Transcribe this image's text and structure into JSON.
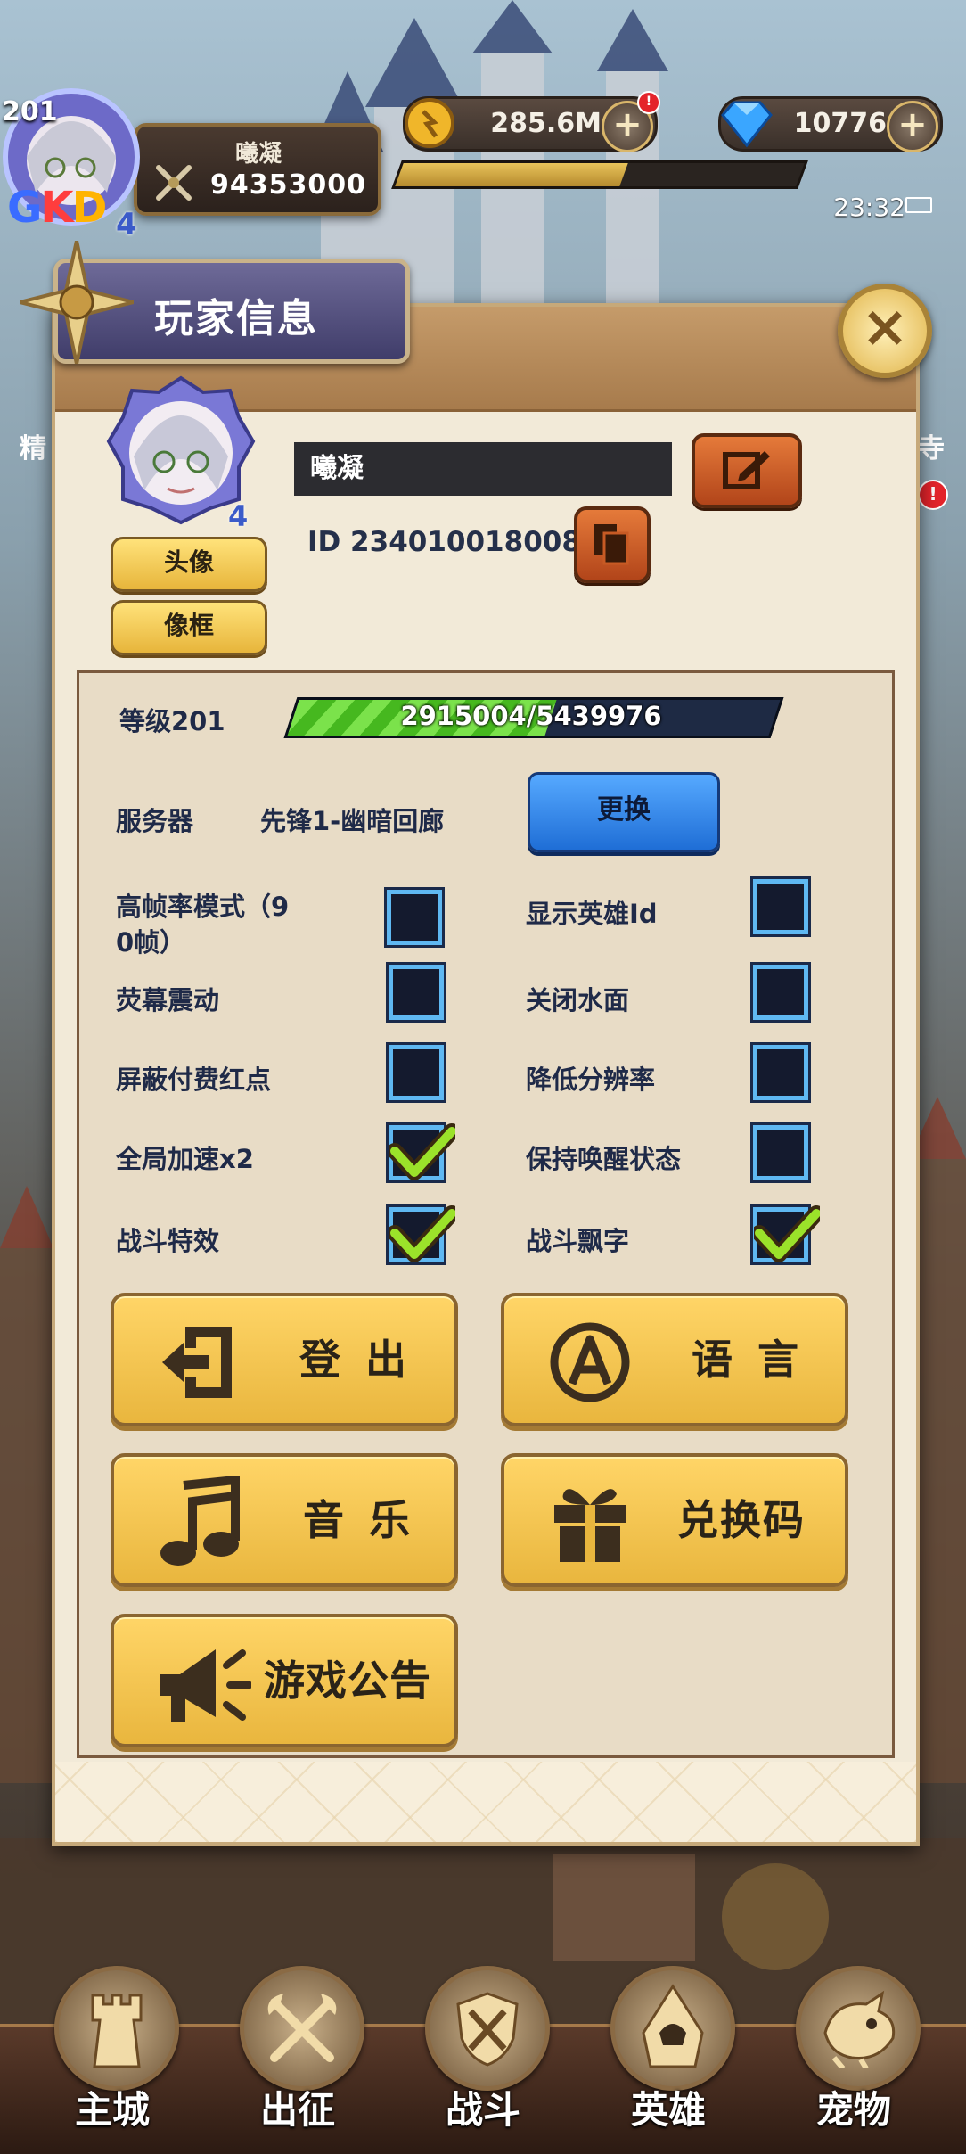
{
  "hud": {
    "level": "201",
    "player_name": "曦凝",
    "power": "94353000",
    "gkd": [
      "G",
      "K",
      "D"
    ],
    "star_level": "4",
    "gold": "285.6M",
    "gems": "10776",
    "time": "23:32",
    "plus_symbol": "+",
    "alert_symbol": "!",
    "gold_alert": true,
    "exp_fraction": 0.56
  },
  "background_fragments": {
    "left_label": "精",
    "right_label": "寺"
  },
  "dialog": {
    "title": "玩家信息",
    "close_symbol": "×",
    "name_value": "曦凝",
    "id_text": "ID 2340100180085",
    "star_level": "4",
    "avatar_button": "头像",
    "frame_button": "像框"
  },
  "settings": {
    "level_label": "等级201",
    "exp_text": "2915004/5439976",
    "exp_fraction": 0.536,
    "server_label": "服务器",
    "server_value": "先锋1-幽暗回廊",
    "change_button": "更换",
    "options": [
      {
        "key": "high_fps",
        "label": "高帧率模式（90帧）",
        "label_line1": "高帧率模式（9",
        "label_line2": "0帧）",
        "checked": false
      },
      {
        "key": "show_hero_id",
        "label": "显示英雄Id",
        "checked": false
      },
      {
        "key": "screen_shake",
        "label": "荧幕震动",
        "checked": false
      },
      {
        "key": "close_water",
        "label": "关闭水面",
        "checked": false
      },
      {
        "key": "hide_paid_dot",
        "label": "屏蔽付费红点",
        "checked": false
      },
      {
        "key": "lower_res",
        "label": "降低分辨率",
        "checked": false
      },
      {
        "key": "global_speed",
        "label": "全局加速x2",
        "checked": true
      },
      {
        "key": "keep_awake",
        "label": "保持唤醒状态",
        "checked": false
      },
      {
        "key": "battle_fx",
        "label": "战斗特效",
        "checked": true
      },
      {
        "key": "battle_text",
        "label": "战斗飘字",
        "checked": true
      }
    ]
  },
  "actions": {
    "logout": "登 出",
    "language": "语 言",
    "music": "音 乐",
    "redeem": "兑换码",
    "announcement": "游戏公告"
  },
  "nav": [
    {
      "label": "主城",
      "icon": "castle-icon"
    },
    {
      "label": "出征",
      "icon": "crossed-axes-icon"
    },
    {
      "label": "战斗",
      "icon": "crossed-swords-shield-icon"
    },
    {
      "label": "英雄",
      "icon": "hooded-hero-icon"
    },
    {
      "label": "宠物",
      "icon": "dragon-pet-icon"
    }
  ],
  "colors": {
    "accent_gold": "#e9b63e",
    "checkbox_border": "#5fb8f2",
    "check_green": "#9be22a",
    "title_banner": "#54507e",
    "change_button_blue": "#2f86ec",
    "exp_green": "#6bd63b"
  }
}
